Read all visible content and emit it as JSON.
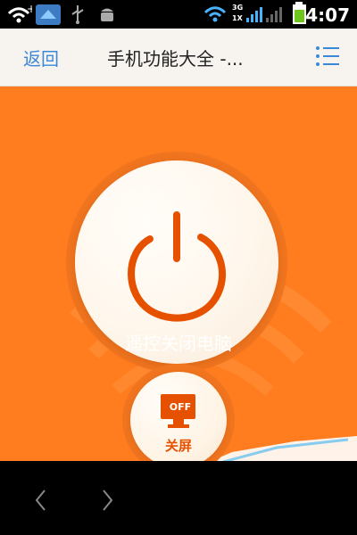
{
  "status_bar": {
    "time": "4:07",
    "network_3g": "3G",
    "network_1x": "1X"
  },
  "header": {
    "back_label": "返回",
    "title": "手机功能大全 -..."
  },
  "controls": [
    {
      "label": "遥控关闭电脑"
    },
    {
      "label": "关屏",
      "icon_text": "OFF"
    }
  ],
  "colors": {
    "accent": "#ff7d1f",
    "blue": "#3b88d8",
    "dark_orange": "#e65100"
  },
  "icons": [
    "wifi-icon",
    "app-icon",
    "usb-icon",
    "android-icon",
    "battery-icon",
    "menu-icon",
    "power-icon",
    "monitor-icon",
    "back-arrow-icon",
    "forward-arrow-icon"
  ]
}
